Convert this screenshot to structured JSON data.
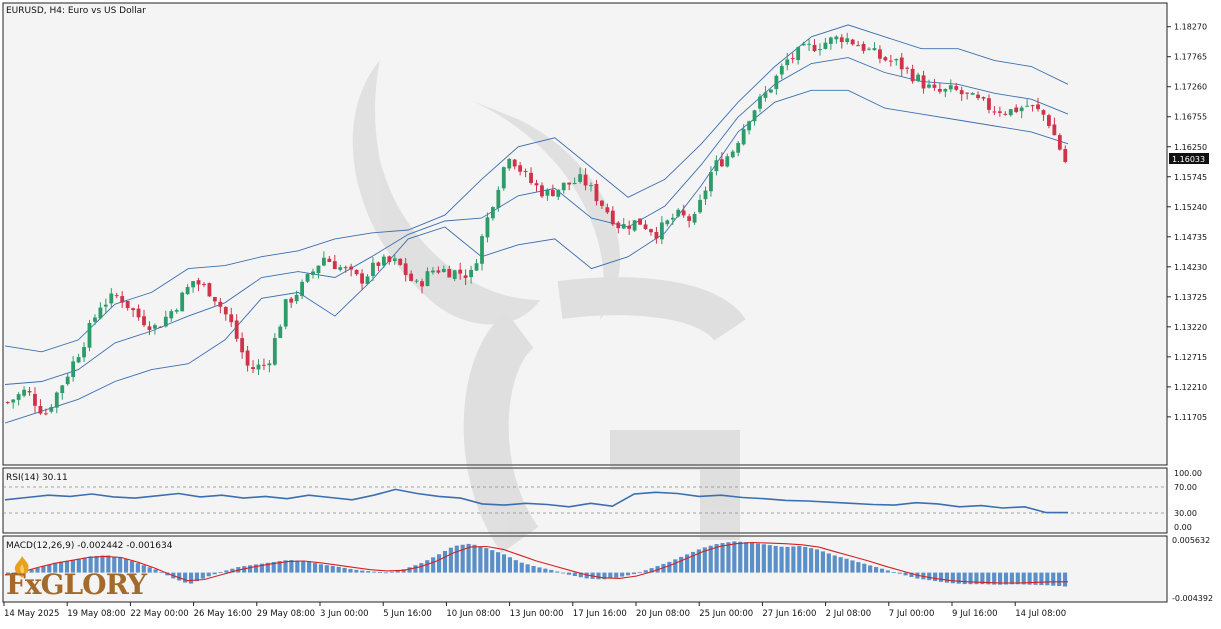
{
  "header": {
    "symbol_title": "EURUSD, H4:  Euro vs US Dollar"
  },
  "colors": {
    "bull": "#26a69a",
    "bull_candle": "#2e9c6a",
    "bear": "#d0324a",
    "band": "#3b6fb0",
    "rsi": "#3b6fb0",
    "macd_hist": "#5b8fc8",
    "signal": "#d62020",
    "background": "#f4f4f4",
    "grid_text": "#222222"
  },
  "price_axis": {
    "ticks": [
      "1.18270",
      "1.17765",
      "1.17260",
      "1.16755",
      "1.16250",
      "1.15745",
      "1.15240",
      "1.14735",
      "1.14230",
      "1.13725",
      "1.13220",
      "1.12715",
      "1.12210",
      "1.11705"
    ],
    "current_price": "1.16033"
  },
  "rsi": {
    "label": "RSI(14) 30.11",
    "ticks": [
      "100.00",
      "70.00",
      "30.00",
      "0.00"
    ]
  },
  "macd": {
    "label": "MACD(12,26,9) -0.002442 -0.001634",
    "ticks": [
      "0.005632",
      "-0.004392"
    ]
  },
  "time_axis": {
    "labels": [
      "14 May 2025",
      "19 May 08:00",
      "22 May 00:00",
      "26 May 16:00",
      "29 May 08:00",
      "3 Jun 00:00",
      "5 Jun 16:00",
      "10 Jun 08:00",
      "13 Jun 00:00",
      "17 Jun 16:00",
      "20 Jun 08:00",
      "25 Jun 00:00",
      "27 Jun 16:00",
      "2 Jul 08:00",
      "7 Jul 00:00",
      "9 Jul 16:00",
      "14 Jul 08:00"
    ]
  },
  "branding": {
    "watermark_letter": "G",
    "logo_text": "FxGLORY"
  },
  "chart_data": [
    {
      "type": "candlestick",
      "title": "EURUSD, H4:  Euro vs US Dollar",
      "x": [
        "14 May 2025",
        "19 May 08:00",
        "22 May 00:00",
        "26 May 16:00",
        "29 May 08:00",
        "3 Jun 00:00",
        "5 Jun 16:00",
        "10 Jun 08:00",
        "13 Jun 00:00",
        "17 Jun 16:00",
        "20 Jun 08:00",
        "25 Jun 00:00",
        "27 Jun 16:00",
        "2 Jul 08:00",
        "7 Jul 00:00",
        "9 Jul 16:00",
        "14 Jul 08:00"
      ],
      "close_path": [
        1.1195,
        1.1215,
        1.1175,
        1.123,
        1.129,
        1.136,
        1.1375,
        1.134,
        1.132,
        1.1355,
        1.14,
        1.138,
        1.133,
        1.125,
        1.126,
        1.136,
        1.1395,
        1.144,
        1.142,
        1.14,
        1.143,
        1.143,
        1.139,
        1.142,
        1.1415,
        1.141,
        1.152,
        1.1615,
        1.157,
        1.1545,
        1.156,
        1.157,
        1.153,
        1.149,
        1.15,
        1.148,
        1.151,
        1.15,
        1.159,
        1.1615,
        1.168,
        1.172,
        1.177,
        1.179,
        1.18,
        1.181,
        1.1795,
        1.1775,
        1.1765,
        1.174,
        1.1715,
        1.172,
        1.1705,
        1.169,
        1.1685,
        1.1695,
        1.1675,
        1.16
      ],
      "bollinger": {
        "upper": [
          1.129,
          1.128,
          1.13,
          1.136,
          1.138,
          1.142,
          1.1425,
          1.144,
          1.145,
          1.147,
          1.148,
          1.1485,
          1.151,
          1.157,
          1.1625,
          1.164,
          1.159,
          1.154,
          1.157,
          1.163,
          1.17,
          1.176,
          1.181,
          1.183,
          1.181,
          1.179,
          1.179,
          1.177,
          1.176,
          1.173
        ],
        "lower": [
          1.116,
          1.118,
          1.12,
          1.123,
          1.125,
          1.126,
          1.13,
          1.137,
          1.138,
          1.134,
          1.14,
          1.147,
          1.149,
          1.144,
          1.146,
          1.147,
          1.142,
          1.144,
          1.148,
          1.156,
          1.165,
          1.17,
          1.172,
          1.172,
          1.169,
          1.168,
          1.167,
          1.166,
          1.165,
          1.163
        ]
      },
      "ylim": [
        1.114,
        1.1845
      ]
    },
    {
      "type": "line",
      "title": "RSI(14) 30.11",
      "values": [
        52,
        56,
        60,
        58,
        62,
        57,
        55,
        59,
        63,
        57,
        60,
        55,
        58,
        54,
        60,
        56,
        52,
        60,
        70,
        63,
        58,
        55,
        45,
        43,
        46,
        44,
        40,
        46,
        41,
        62,
        65,
        63,
        58,
        60,
        56,
        54,
        51,
        50,
        48,
        46,
        44,
        43,
        47,
        45,
        40,
        42,
        38,
        40,
        30,
        30
      ],
      "levels": [
        70,
        30
      ],
      "ylim": [
        0,
        100
      ]
    },
    {
      "type": "bar",
      "title": "MACD(12,26,9) -0.002442 -0.001634",
      "histogram": [
        -0.0005,
        0.0002,
        0.001,
        0.0018,
        0.0022,
        0.0028,
        0.003,
        0.0025,
        0.0015,
        0.0005,
        -0.001,
        -0.002,
        -0.0008,
        0.0002,
        0.001,
        0.0014,
        0.0018,
        0.0022,
        0.002,
        0.0014,
        0.001,
        0.0005,
        0.0002,
        0.0,
        0.0006,
        0.0016,
        0.003,
        0.0046,
        0.005,
        0.0042,
        0.0032,
        0.0018,
        0.001,
        0.0004,
        -0.0004,
        -0.001,
        -0.0012,
        -0.0008,
        -0.0002,
        0.0008,
        0.0018,
        0.003,
        0.0042,
        0.005,
        0.0054,
        0.0052,
        0.0048,
        0.0044,
        0.0046,
        0.004,
        0.003,
        0.0022,
        0.0014,
        0.0006,
        -0.0002,
        -0.001,
        -0.0014,
        -0.0018,
        -0.002,
        -0.002,
        -0.0021,
        -0.002,
        -0.0021,
        -0.0022,
        -0.0024
      ],
      "signal": [
        -0.0004,
        0.0001,
        0.0009,
        0.0016,
        0.0021,
        0.0026,
        0.0028,
        0.0026,
        0.0018,
        0.0008,
        -0.0004,
        -0.0014,
        -0.0012,
        -0.0004,
        0.0004,
        0.001,
        0.0015,
        0.0019,
        0.002,
        0.0017,
        0.0013,
        0.0009,
        0.0005,
        0.0003,
        0.0004,
        0.001,
        0.002,
        0.0034,
        0.0044,
        0.0045,
        0.004,
        0.003,
        0.002,
        0.0012,
        0.0004,
        -0.0004,
        -0.0009,
        -0.001,
        -0.0006,
        0.0002,
        0.0012,
        0.0024,
        0.0036,
        0.0045,
        0.005,
        0.0052,
        0.0051,
        0.005,
        0.0048,
        0.0044,
        0.0036,
        0.0028,
        0.002,
        0.0011,
        0.0003,
        -0.0005,
        -0.001,
        -0.0014,
        -0.0016,
        -0.0017,
        -0.0018,
        -0.0018,
        -0.0017,
        -0.0016,
        -0.0016
      ],
      "ylim": [
        -0.004392,
        0.005632
      ]
    }
  ]
}
